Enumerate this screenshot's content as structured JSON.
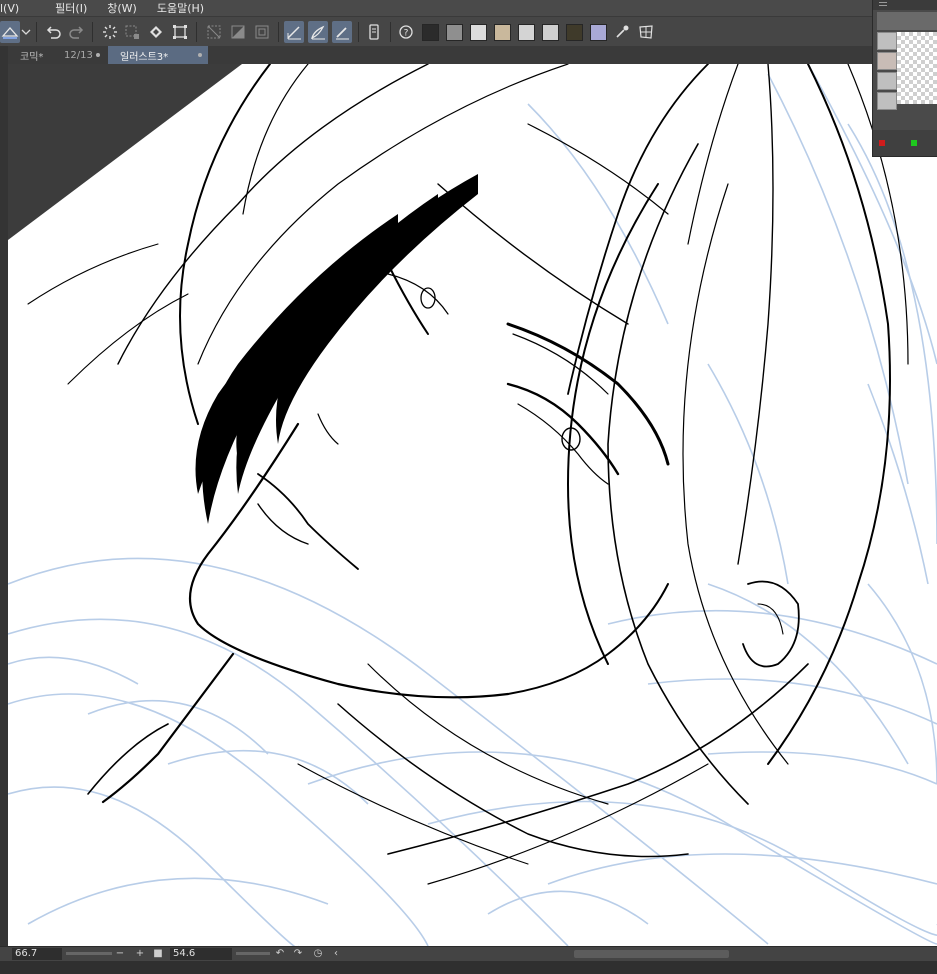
{
  "menu": {
    "items": [
      "l(V)",
      "필터(I)",
      "창(W)",
      "도움말(H)"
    ]
  },
  "toolbar": {
    "swatch_colors": [
      "#2b2b2b",
      "#8f8f8f",
      "#dcdcdc",
      "#c9b89c",
      "#d4d4d4",
      "#cfcfcf",
      "#3f3a2a",
      "#a9a9d6"
    ]
  },
  "tabs": [
    {
      "label": "코믹*",
      "page": "12/13",
      "active": false
    },
    {
      "label": "일러스트3*",
      "active": true
    }
  ],
  "statusbar": {
    "zoom": "66.7",
    "rotation": "54.6",
    "minus": "−",
    "plus": "+"
  },
  "colors": {
    "sketch_blue": "#b8cde8",
    "ink": "#000000",
    "active_tab": "#5b6b82"
  }
}
